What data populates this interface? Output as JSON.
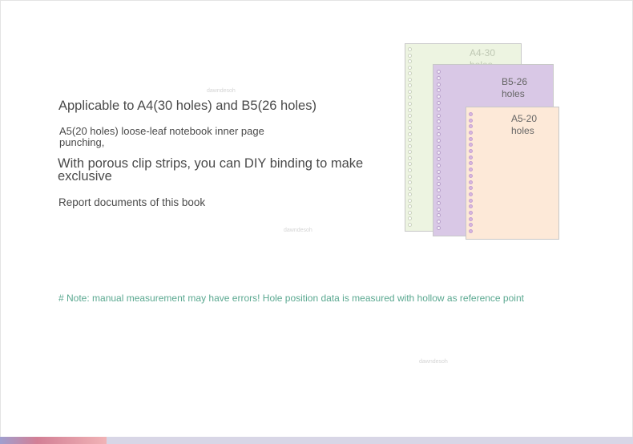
{
  "content": {
    "heading": "Applicable to A4(30 holes) and B5(26 holes)",
    "subtext": "A5(20 holes) loose-leaf notebook inner page punching,",
    "feature": "With porous clip strips, you can DIY binding to make exclusive",
    "report": "Report documents of this book",
    "note": "# Note: manual measurement may have errors! Hole position data is measured with hollow as reference point"
  },
  "watermark": "dawndesoh",
  "illustration": {
    "a4": {
      "label": "A4-30 holes",
      "holes": 30
    },
    "b5": {
      "label": "B5-26 holes",
      "holes": 26
    },
    "a5": {
      "label": "A5-20 holes",
      "holes": 20
    }
  },
  "colors": {
    "a4_sheet": "#edf4e1",
    "b5_sheet": "#d9c8e6",
    "a5_sheet": "#fde9d8",
    "note_text": "#5aa890"
  }
}
